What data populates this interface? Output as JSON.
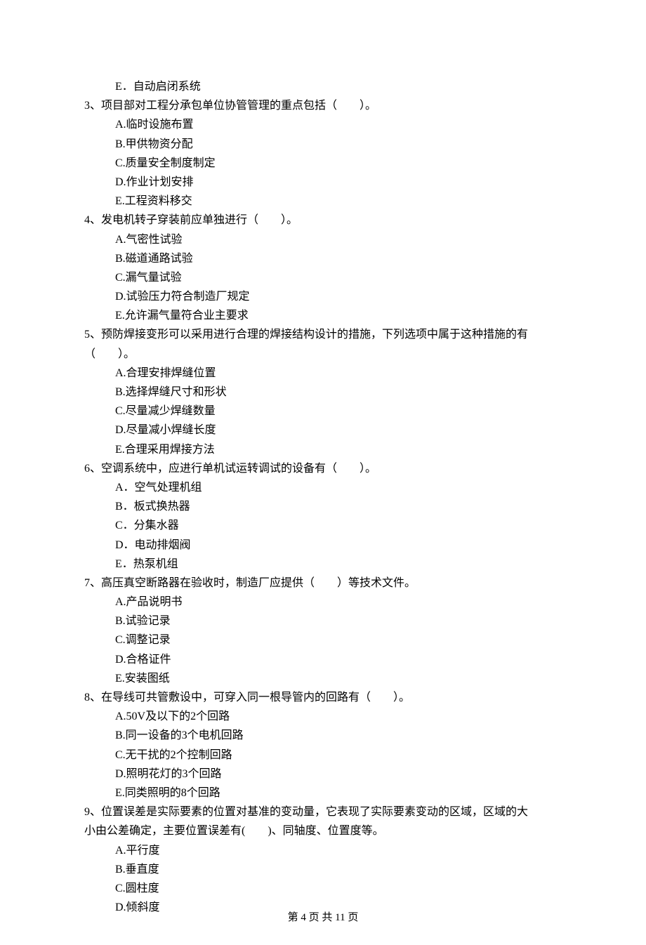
{
  "lines": [
    {
      "cls": "option-line",
      "text": "E．自动启闭系统"
    },
    {
      "cls": "question-line",
      "text": "3、项目部对工程分承包单位协管管理的重点包括（　　）。"
    },
    {
      "cls": "option-line",
      "text": "A.临时设施布置"
    },
    {
      "cls": "option-line",
      "text": "B.甲供物资分配"
    },
    {
      "cls": "option-line",
      "text": "C.质量安全制度制定"
    },
    {
      "cls": "option-line",
      "text": "D.作业计划安排"
    },
    {
      "cls": "option-line",
      "text": "E.工程资料移交"
    },
    {
      "cls": "question-line",
      "text": "4、发电机转子穿装前应单独进行（　　）。"
    },
    {
      "cls": "option-line",
      "text": "A.气密性试验"
    },
    {
      "cls": "option-line",
      "text": "B.磁道通路试验"
    },
    {
      "cls": "option-line",
      "text": "C.漏气量试验"
    },
    {
      "cls": "option-line",
      "text": "D.试验压力符合制造厂规定"
    },
    {
      "cls": "option-line",
      "text": "E.允许漏气量符合业主要求"
    },
    {
      "cls": "question-line",
      "text": "5、预防焊接变形可以采用进行合理的焊接结构设计的措施，下列选项中属于这种措施的有"
    },
    {
      "cls": "continuation-line",
      "text": "（　　）。"
    },
    {
      "cls": "option-line",
      "text": "A.合理安排焊缝位置"
    },
    {
      "cls": "option-line",
      "text": "B.选择焊缝尺寸和形状"
    },
    {
      "cls": "option-line",
      "text": "C.尽量减少焊缝数量"
    },
    {
      "cls": "option-line",
      "text": "D.尽量减小焊缝长度"
    },
    {
      "cls": "option-line",
      "text": "E.合理采用焊接方法"
    },
    {
      "cls": "question-line",
      "text": "6、空调系统中，应进行单机试运转调试的设备有（　　）。"
    },
    {
      "cls": "option-line",
      "text": "A．空气处理机组"
    },
    {
      "cls": "option-line",
      "text": "B．板式换热器"
    },
    {
      "cls": "option-line",
      "text": "C．分集水器"
    },
    {
      "cls": "option-line",
      "text": "D．电动排烟阀"
    },
    {
      "cls": "option-line",
      "text": "E．热泵机组"
    },
    {
      "cls": "question-line",
      "text": "7、高压真空断路器在验收时，制造厂应提供（　　）等技术文件。"
    },
    {
      "cls": "option-line",
      "text": "A.产品说明书"
    },
    {
      "cls": "option-line",
      "text": "B.试验记录"
    },
    {
      "cls": "option-line",
      "text": "C.调整记录"
    },
    {
      "cls": "option-line",
      "text": "D.合格证件"
    },
    {
      "cls": "option-line",
      "text": "E.安装图纸"
    },
    {
      "cls": "question-line",
      "text": "8、在导线可共管敷设中，可穿入同一根导管内的回路有（　　）。"
    },
    {
      "cls": "option-line",
      "text": "A.50V及以下的2个回路"
    },
    {
      "cls": "option-line",
      "text": "B.同一设备的3个电机回路"
    },
    {
      "cls": "option-line",
      "text": "C.无干扰的2个控制回路"
    },
    {
      "cls": "option-line",
      "text": "D.照明花灯的3个回路"
    },
    {
      "cls": "option-line",
      "text": "E.同类照明的8个回路"
    },
    {
      "cls": "question-line",
      "text": "9、位置误差是实际要素的位置对基准的变动量，它表现了实际要素变动的区域，区域的大"
    },
    {
      "cls": "continuation-line",
      "text": "小由公差确定，主要位置误差有(　　)、同轴度、位置度等。"
    },
    {
      "cls": "option-line",
      "text": "A.平行度"
    },
    {
      "cls": "option-line",
      "text": "B.垂直度"
    },
    {
      "cls": "option-line",
      "text": "C.圆柱度"
    },
    {
      "cls": "option-line",
      "text": "D.倾斜度"
    }
  ],
  "footer": "第 4 页 共 11 页"
}
